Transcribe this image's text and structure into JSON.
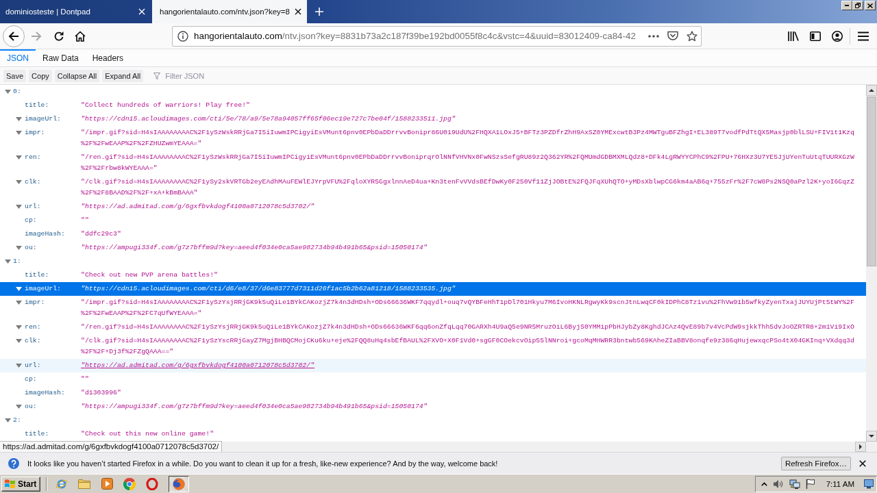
{
  "browser_tabs": [
    {
      "title": "dominiosteste | Dontpad",
      "selected": false
    },
    {
      "title": "hangorientalauto.com/ntv.json?key=8",
      "selected": true
    }
  ],
  "navigation": {
    "forward": {
      "disabled": true
    }
  },
  "address_bar": {
    "host": "hangorientalauto.com",
    "path": "/ntv.json?key=8831b73a2c187f39be192bd0055f8c4c&vstc=4&uuid=83012409-ca84-42"
  },
  "viewer_tabs": [
    {
      "label": "JSON",
      "selected": true
    },
    {
      "label": "Raw Data",
      "selected": false
    },
    {
      "label": "Headers",
      "selected": false
    }
  ],
  "viewer_toolbar": {
    "buttons": [
      "Save",
      "Copy",
      "Collapse All",
      "Expand All"
    ],
    "filter": {
      "placeholder": "Filter JSON"
    }
  },
  "tree": [
    {
      "key": "0:",
      "expanded": true,
      "selected": false,
      "hovered": false,
      "fields": [
        {
          "key": "title:",
          "has_toggle": false,
          "kind": "string",
          "lines": [
            "\"Collect hundreds of warriors! Play free!\""
          ],
          "selected": false,
          "hovered": false
        },
        {
          "key": "imageUrl:",
          "has_toggle": true,
          "kind": "url",
          "lines": [
            "\"https://cdn15.acloudimages.com/cti/5e/78/a9/5e78a94057ff65f06ec19e727c7be04f/1588233511.jpg\""
          ],
          "selected": false,
          "hovered": false
        },
        {
          "key": "impr:",
          "has_toggle": true,
          "kind": "string",
          "lines": [
            "\"/impr.gif?sid=H4sIAAAAAAAAC%2F1ySzWskRRjGa7I5iIuwmIPCigyiEsVMunt6pnv0EPbDaDDrrvvBonipr86U019UdU%2FHQXA1LOxJ5+BFTz3PZDfrZhH9AxSZ0YMExcwtB3Pz4MWTguBFZhgI+EL389T7vodfPdTtQX5Masjp0blLSU+FIV1t1Kzq",
            "%2F%2FwEAAP%2F%2FZHUZwmYEAAA=\""
          ],
          "selected": false,
          "hovered": false
        },
        {
          "key": "ren:",
          "has_toggle": true,
          "kind": "string",
          "lines": [
            "\"/ren.gif?sid=H4sIAAAAAAAAC%2F1ySzWskRRjGa7I5iIuwmIPCigyiEsVMunt6pnv0EPbDaDDrrvvBoniprqrOlNNfVHVNx0FwNSzsSefgRU89z2Q362YR%2FQMUmdGDBMXMLQdz8+DFk4LgRWYYCPhC9%2FPU+76HXz3U7YE5JjUYenTuUtqTUURXGzW",
            "%2F%2Frbw8kWYEAAA=\""
          ],
          "selected": false,
          "hovered": false
        },
        {
          "key": "clk:",
          "has_toggle": true,
          "kind": "string",
          "lines": [
            "\"/clk.gif?sid=H4sIAAAAAAAAC%2F1ySy2skVRTGb2eyEAdhMAuFEWlEJYrpVFU%2FqloXYR5GgxlnnAeD4ua+Kn3tenFvVVdsBEfDwKy0F250Vf11ZjJOBtE%2FQJFqXUhQTO+yMDsXblwpCG6km4aAB6q+755zFr%2F7cW8Ps2NSQ0aPzl2K+yoI6GqzZ",
            "%2F%2F8BAAD%2F%2F+xA+kBmBAAA\""
          ],
          "selected": false,
          "hovered": false
        },
        {
          "key": "url:",
          "has_toggle": true,
          "kind": "url",
          "lines": [
            "\"https://ad.admitad.com/g/6gxfbvkdogf4100a0712078c5d3702/\""
          ],
          "selected": false,
          "hovered": false
        },
        {
          "key": "cp:",
          "has_toggle": false,
          "kind": "string",
          "lines": [
            "\"\""
          ],
          "selected": false,
          "hovered": false
        },
        {
          "key": "imageHash:",
          "has_toggle": false,
          "kind": "string",
          "lines": [
            "\"ddfc29c3\""
          ],
          "selected": false,
          "hovered": false
        },
        {
          "key": "ou:",
          "has_toggle": true,
          "kind": "url",
          "lines": [
            "\"https://ampugi334f.com/g7z7bffm9d?key=aeed4f034e0ca5ae982734b94b491b65&psid=15050174\""
          ],
          "selected": false,
          "hovered": false
        }
      ]
    },
    {
      "key": "1:",
      "expanded": true,
      "selected": false,
      "hovered": false,
      "fields": [
        {
          "key": "title:",
          "has_toggle": false,
          "kind": "string",
          "lines": [
            "\"Check out new PVP arena battles!\""
          ],
          "selected": false,
          "hovered": false
        },
        {
          "key": "imageUrl:",
          "has_toggle": true,
          "kind": "url",
          "lines": [
            "\"https://cdn15.acloudimages.com/cti/d6/e8/37/d6e83777d7311d26f1ac5b2b62a81218/1588233535.jpg\""
          ],
          "selected": true,
          "hovered": false
        },
        {
          "key": "impr:",
          "has_toggle": true,
          "kind": "string",
          "lines": [
            "\"/impr.gif?sid=H4sIAAAAAAAAC%2F1ySzYsjRRjGK9k5uQiLe1BYkCAKozjZ7k4n3dHDsh+ODs66636WKF7qqydl+ouq7vQYBFeHhT1pDl701Hkyu7M6IvoHKNLRgwyKk9scnJtnLwqCF0kIDPhC8Tz1vu%2FhVw91b5wfkyZyenTxajJUYUjPt5tWY%2F",
            "%2F%2FwEAAP%2F%2FC7qUfWYEAAA=\""
          ],
          "selected": false,
          "hovered": false
        },
        {
          "key": "ren:",
          "has_toggle": true,
          "kind": "string",
          "lines": [
            "\"/ren.gif?sid=H4sIAAAAAAAAC%2F1ySzYsjRRjGK9k5uQiLe1BYkCAKozjZ7k4n3dHDsh+ODs66636WKF6qq6onZfqLqq70GARXh4U9aQ5e9NR5MruzOiL6ByjS0YMMipPbHJybZy8KghdJCAz4QvE89b7v4VcPdW9sjkkThh5dvJoOZRTR8+2m1Vi9IxO"
          ],
          "selected": false,
          "hovered": false
        },
        {
          "key": "clk:",
          "has_toggle": true,
          "kind": "string",
          "lines": [
            "\"/clk.gif?sid=H4sIAAAAAAAAC%2F1ySzYscRRjGayZ7MgjBHBQCMojCKu6ku+eje%2FQQ8uHq4sbEfBAUL%2FXVO+X0F1Vd0+sgGF0COekcvOip55lNNroi+gcoMqMHWRR3bntwb569KAheZIaBBV8onqfe9z386qHujewxqcPSo4tX04GKInq+VXdqq3d",
            "%2F%2F+Dj3f%2FZgQAAA==\""
          ],
          "selected": false,
          "hovered": false
        },
        {
          "key": "url:",
          "has_toggle": true,
          "kind": "url",
          "lines": [
            "\"https://ad.admitad.com/g/6gxfbvkdogf4100a0712078c5d3702/\""
          ],
          "selected": false,
          "hovered": true
        },
        {
          "key": "cp:",
          "has_toggle": false,
          "kind": "string",
          "lines": [
            "\"\""
          ],
          "selected": false,
          "hovered": false
        },
        {
          "key": "imageHash:",
          "has_toggle": false,
          "kind": "string",
          "lines": [
            "\"d1303996\""
          ],
          "selected": false,
          "hovered": false
        },
        {
          "key": "ou:",
          "has_toggle": true,
          "kind": "url",
          "lines": [
            "\"https://ampugi334f.com/g7z7bffm9d?key=aeed4f034e0ca5ae982734b94b491b65&psid=15050174\""
          ],
          "selected": false,
          "hovered": false
        }
      ]
    },
    {
      "key": "2:",
      "expanded": true,
      "selected": false,
      "hovered": false,
      "fields": [
        {
          "key": "title:",
          "has_toggle": false,
          "kind": "string",
          "lines": [
            "\"Check out this new online game!\""
          ],
          "selected": false,
          "hovered": false
        }
      ]
    }
  ],
  "link_status": "https://ad.admitad.com/g/6gxfbvkdogf4100a0712078c5d3702/",
  "notification": {
    "message": "It looks like you haven’t started Firefox in a while. Do you want to clean it up for a fresh, like-new experience? And by the way, welcome back!",
    "button": "Refresh Firefox…"
  },
  "taskbar": {
    "start": "Start",
    "apps": [
      {
        "kind": "orbit",
        "selected": false
      },
      {
        "kind": "folder",
        "selected": false
      },
      {
        "kind": "play",
        "selected": false
      },
      {
        "kind": "segments",
        "selected": false
      },
      {
        "kind": "ring",
        "selected": false
      },
      {
        "kind": "swirl",
        "selected": true
      }
    ],
    "clock": "7:11 AM"
  }
}
